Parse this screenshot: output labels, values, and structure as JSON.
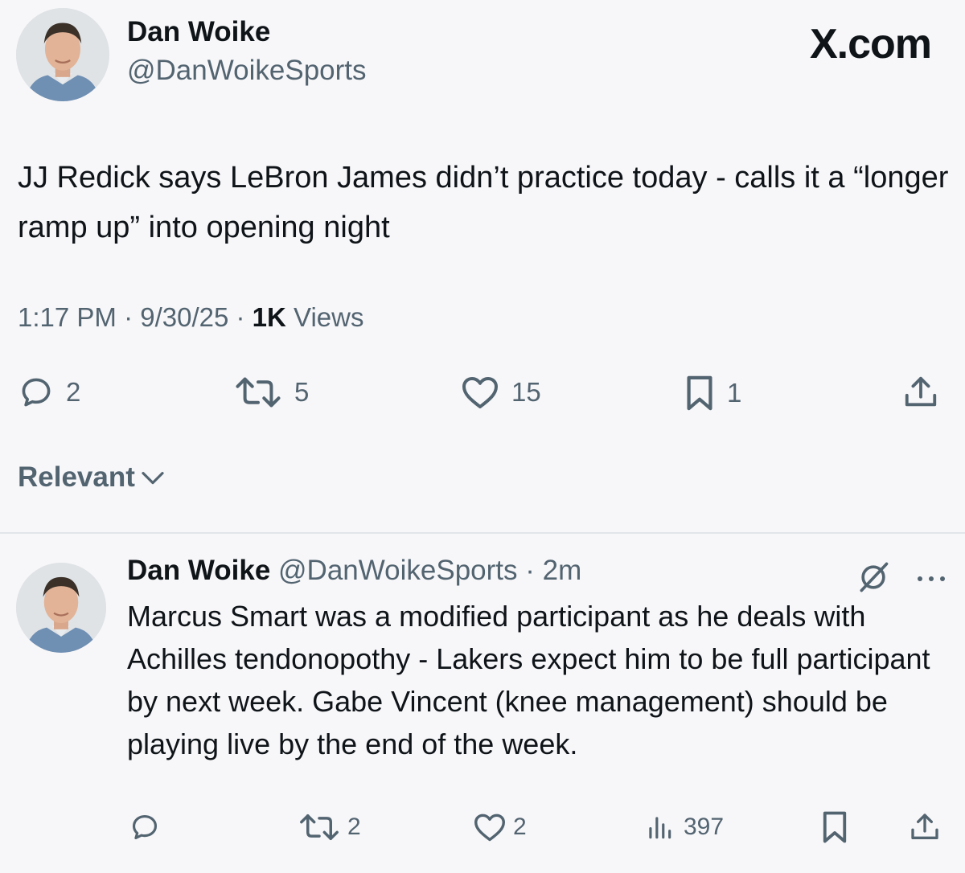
{
  "brand": "X.com",
  "tweet": {
    "author_name": "Dan Woike",
    "author_handle": "@DanWoikeSports",
    "text": "JJ Redick says LeBron James didn’t practice today - calls it a “longer ramp up” into opening night",
    "time": "1:17 PM",
    "date": "9/30/25",
    "views_count": "1K",
    "views_label": "Views",
    "replies": "2",
    "reposts": "5",
    "likes": "15",
    "bookmarks": "1"
  },
  "sort_label": "Relevant",
  "reply": {
    "author_name": "Dan Woike",
    "author_handle": "@DanWoikeSports",
    "time_ago": "2m",
    "text": "Marcus Smart was a modified participant as he deals with Achilles tendonopothy - Lakers expect him to be full participant by next week. Gabe Vincent (knee management) should be playing live by the end of the week.",
    "reposts": "2",
    "likes": "2",
    "views": "397"
  },
  "icons": {
    "reply": "reply-icon",
    "repost": "repost-icon",
    "like": "heart-icon",
    "bookmark": "bookmark-icon",
    "share": "share-icon",
    "views": "views-icon",
    "grok": "grok-icon",
    "more": "more-icon",
    "chevron": "chevron-down-icon"
  },
  "colors": {
    "background": "#f7f7f9",
    "text": "#0f1419",
    "secondary": "#536471",
    "divider": "#e1e6ea"
  }
}
